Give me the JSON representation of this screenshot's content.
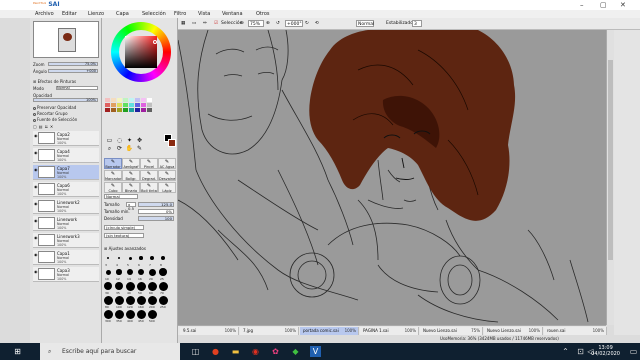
{
  "app": {
    "logo_main": "SAI",
    "logo_sub": "PaintTool",
    "menu": [
      "Archivo",
      "Editar",
      "Lienzo",
      "Capa",
      "Selección",
      "Filtro",
      "Vista",
      "Ventana",
      "Otros"
    ]
  },
  "toolbar": {
    "zoom": "75%",
    "selection_label": "Selección",
    "rotation": "+000°",
    "blend_mode": "Normal",
    "stabilizer_label": "Estabilizador",
    "stabilizer_value": "3"
  },
  "navigator": {
    "zoom_label": "Zoom",
    "zoom_value": "75.0%",
    "angle_label": "Ángulo",
    "angle_value": "+000"
  },
  "layer_panel": {
    "effects_label": "Efectos de Pinturas",
    "mode_label": "Modo",
    "mode_value": "Normal",
    "opacity_label": "Opacidad",
    "opacity_value": "100%",
    "options": [
      "Preservar Opacidad",
      "Recortar Grupo",
      "Fuente de Selección"
    ],
    "layers": [
      {
        "name": "Capa2",
        "mode": "Normal",
        "opacity": "100%"
      },
      {
        "name": "Capa4",
        "mode": "Normal",
        "opacity": "100%"
      },
      {
        "name": "Capa7",
        "mode": "Normal",
        "opacity": "100%"
      },
      {
        "name": "Capa6",
        "mode": "Normal",
        "opacity": "100%"
      },
      {
        "name": "Lineswork2",
        "mode": "Normal",
        "opacity": "100%"
      },
      {
        "name": "Lineswork",
        "mode": "Normal",
        "opacity": "100%"
      },
      {
        "name": "Lineswork3",
        "mode": "Normal",
        "opacity": "100%"
      },
      {
        "name": "Capa1",
        "mode": "Normal",
        "opacity": "100%"
      },
      {
        "name": "Capa3",
        "mode": "Normal",
        "opacity": "100%"
      }
    ]
  },
  "tools": {
    "buttons": [
      "Borrador",
      "Aerógraf",
      "Pincel",
      "AC Agua",
      "Marcador",
      "Bolígr.",
      "Degrad.",
      "Desvaine",
      "Cubo",
      "Binario",
      "Boli tinta",
      "Lápiz"
    ],
    "active_index": 0,
    "mode_value": "Normal",
    "size_label": "Tamaño",
    "size_mult": "x 0.5",
    "size_value": "125.0",
    "min_size_label": "Tamaño mín.",
    "min_size_value": "0%",
    "density_label": "Densidad",
    "density_value": "100",
    "shape_value": "(círculo simple)",
    "texture_value": "(sin textura)",
    "advanced_label": "Ajustes avanzados",
    "brush_sizes": [
      "3",
      "4",
      "5",
      "6",
      "7",
      "8",
      "10",
      "12",
      "14",
      "16",
      "20",
      "25",
      "30",
      "35",
      "40",
      "50",
      "60",
      "70",
      "80",
      "100",
      "120",
      "160",
      "200",
      "250",
      "300",
      "350",
      "400",
      "450",
      "500"
    ]
  },
  "files": [
    {
      "name": "9.5.sai",
      "zoom": "100%"
    },
    {
      "name": "7.jpg",
      "zoom": "100%"
    },
    {
      "name": "portada comic.sai",
      "zoom": "100%"
    },
    {
      "name": "PAGINA 1.sai",
      "zoom": "100%"
    },
    {
      "name": "Nuevo Lienzo.sai",
      "zoom": "75%"
    },
    {
      "name": "Nuevo Lienzo.sai",
      "zoom": "100%"
    },
    {
      "name": "rouen.sai",
      "zoom": "100%"
    }
  ],
  "active_file_index": 2,
  "status": "UsoMemoria: 36% (3424MB usados / 11746MB reservados)",
  "taskbar": {
    "search_placeholder": "Escribe aquí para buscar",
    "time": "13:09",
    "date": "04/02/2020"
  },
  "colors": {
    "hair_fill": "#5a1f0a",
    "canvas_bg": "#9a9a9a",
    "accent_selected": "#b8c8ee",
    "primary_color": "#000000",
    "secondary_color": "#8a2a10"
  }
}
